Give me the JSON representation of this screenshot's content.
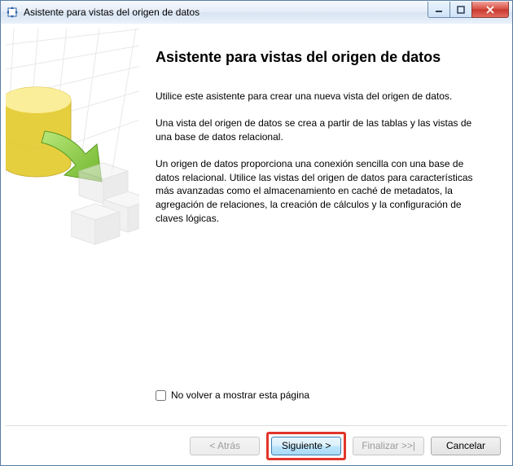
{
  "window": {
    "title": "Asistente para vistas del origen de datos"
  },
  "wizard": {
    "heading": "Asistente para vistas del origen de datos",
    "para1": "Utilice este asistente para crear una nueva vista del origen de datos.",
    "para2": "Una vista del origen de datos se crea a partir de las tablas y las vistas de una base de datos relacional.",
    "para3": "Un origen de datos proporciona una conexión sencilla con una base de datos relacional. Utilice las vistas del origen de datos para características más avanzadas como el almacenamiento en caché de metadatos, la agregación de relaciones, la creación de cálculos y la configuración de claves lógicas.",
    "dont_show_label": "No volver a mostrar esta página"
  },
  "buttons": {
    "back": "< Atrás",
    "next": "Siguiente >",
    "finish": "Finalizar >>|",
    "cancel": "Cancelar"
  }
}
